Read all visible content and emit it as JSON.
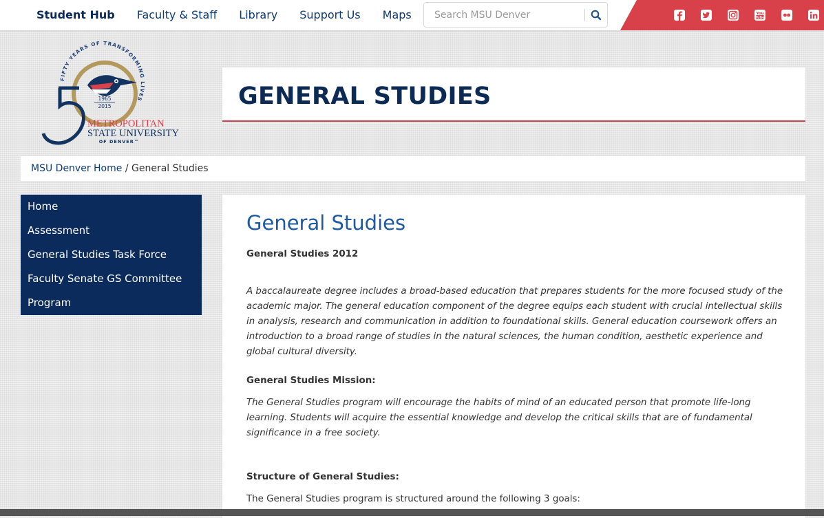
{
  "nav": {
    "items": [
      "Student Hub",
      "Faculty & Staff",
      "Library",
      "Support Us",
      "Maps"
    ]
  },
  "search": {
    "placeholder": "Search MSU Denver"
  },
  "social": {
    "icons": [
      "facebook-icon",
      "twitter-icon",
      "instagram-icon",
      "youtube-icon",
      "flickr-icon",
      "linkedin-icon"
    ],
    "youtube_text": "You Tube"
  },
  "logo": {
    "ring_text": "FIFTY YEARS OF TRANSFORMING LIVES",
    "years_start": "1965",
    "years_end": "2015",
    "line1": "METROPOLITAN",
    "line2": "STATE UNIVERSITY",
    "line3": "OF DENVER™"
  },
  "page": {
    "title": "GENERAL STUDIES"
  },
  "breadcrumb": {
    "home": "MSU Denver Home",
    "sep": " / ",
    "current": "General Studies"
  },
  "sidebar": {
    "items": [
      "Home",
      "Assessment",
      "General Studies Task Force",
      "Faculty Senate GS Committee",
      "Program"
    ]
  },
  "content": {
    "heading": "General Studies",
    "subtitle": "General Studies 2012",
    "intro": "A baccalaureate degree includes a broad-based education that prepares students for the more focused study of the academic major.  The general education component of the degree equips each student with crucial intellectual skills in analysis, research and communication in addition to foundational skills.  General education coursework offers an introduction to a broad range of studies in the natural sciences, the human condition, aesthetic experience and global cultural diversity.",
    "mission_heading": "General Studies Mission:",
    "mission_text": "The General Studies program will encourage the habits of mind of an educated person that promote life-long learning. Students will acquire the essential knowledge and develop the critical skills that are of fundamental significance in a free society.",
    "structure_heading": "Structure of General Studies:",
    "structure_text": "The General Studies program is structured around the following 3 goals:"
  },
  "colors": {
    "navy": "#0a2b5b",
    "red": "#d9414a",
    "link": "#1f5aa0",
    "gold": "#b39a5c"
  }
}
